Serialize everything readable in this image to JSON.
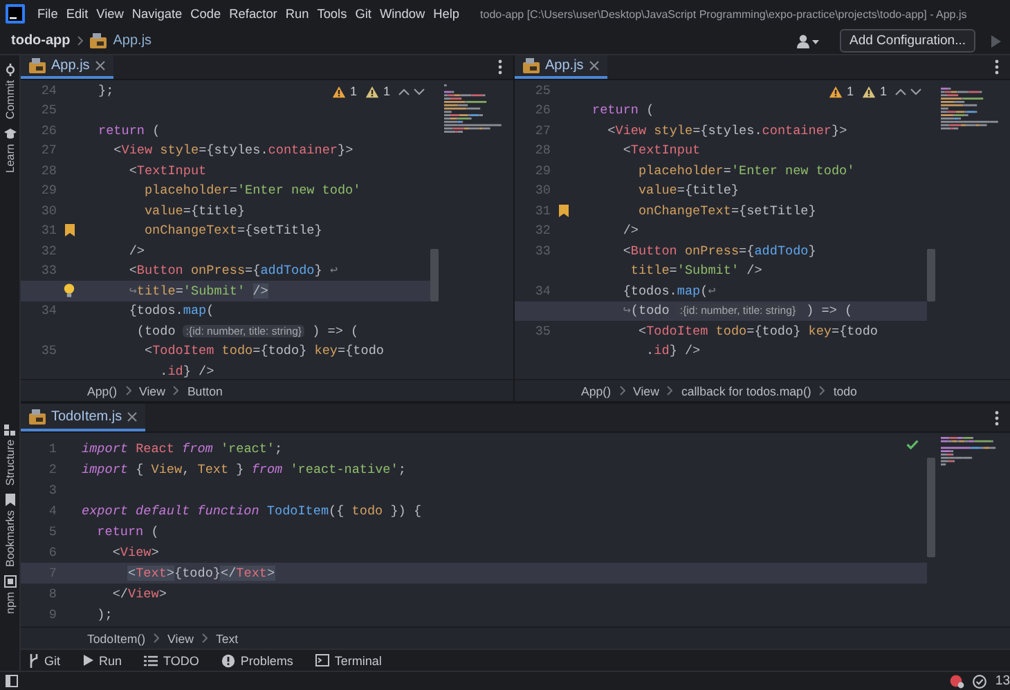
{
  "menu_bar": {
    "items": [
      "File",
      "Edit",
      "View",
      "Navigate",
      "Code",
      "Refactor",
      "Run",
      "Tools",
      "Git",
      "Window",
      "Help"
    ],
    "title": "todo-app [C:\\Users\\user\\Desktop\\JavaScript Programming\\expo-practice\\projects\\todo-app] - App.js"
  },
  "nav_bar": {
    "breadcrumbs": [
      {
        "label": "todo-app",
        "kind": "project"
      },
      {
        "label": "App.js",
        "kind": "file"
      }
    ],
    "config_button": "Add Configuration...",
    "run_disabled": true
  },
  "left_tool_strip": {
    "top": [
      "Commit",
      "Learn"
    ],
    "bottom": [
      "Structure",
      "Bookmarks",
      "npm"
    ]
  },
  "editors": [
    {
      "tabs": [
        {
          "label": "App.js",
          "selected": true
        }
      ],
      "inspections": [
        {
          "kind": "warning",
          "count": "1"
        },
        {
          "kind": "weak_warning",
          "count": "1"
        }
      ],
      "lines": [
        {
          "number": "24",
          "kind": "plain",
          "current": false,
          "tokens": [
            {
              "text": "};",
              "kind": "plain"
            }
          ]
        },
        {
          "number": "25",
          "kind": "plain",
          "current": false
        },
        {
          "number": "26",
          "kind": "plain",
          "current": false,
          "tokens": [
            {
              "text": "return",
              "kind": "kw"
            },
            {
              "text": " (",
              "kind": "plain"
            }
          ]
        },
        {
          "number": "27",
          "kind": "plain",
          "current": false,
          "tokens": [
            {
              "text": "  <",
              "kind": "plain"
            },
            {
              "text": "View ",
              "kind": "tag"
            },
            {
              "text": "style",
              "kind": "attr"
            },
            {
              "text": "={styles.",
              "kind": "plain"
            },
            {
              "text": "container",
              "kind": "prop"
            },
            {
              "text": "}>",
              "kind": "plain"
            }
          ]
        },
        {
          "number": "28",
          "kind": "plain",
          "current": false,
          "tokens": [
            {
              "text": "    <",
              "kind": "plain"
            },
            {
              "text": "TextInput",
              "kind": "tag"
            }
          ]
        },
        {
          "number": "29",
          "kind": "plain",
          "current": false,
          "tokens": [
            {
              "text": "      placeholder",
              "kind": "attr"
            },
            {
              "text": "=",
              "kind": "plain"
            },
            {
              "text": "'Enter new todo'",
              "kind": "str"
            }
          ]
        },
        {
          "number": "30",
          "kind": "plain",
          "current": false,
          "tokens": [
            {
              "text": "      value",
              "kind": "attr"
            },
            {
              "text": "={title}",
              "kind": "plain"
            }
          ]
        },
        {
          "number": "31",
          "kind": "bookmark",
          "current": false,
          "tokens": [
            {
              "text": "      onChangeText",
              "kind": "attr"
            },
            {
              "text": "={setTitle}",
              "kind": "plain"
            }
          ]
        },
        {
          "number": "32",
          "kind": "plain",
          "current": false,
          "tokens": [
            {
              "text": "    />",
              "kind": "plain"
            }
          ]
        },
        {
          "number": "33",
          "kind": "plain",
          "current": false,
          "tokens": [
            {
              "text": "    <",
              "kind": "plain"
            },
            {
              "text": "Button ",
              "kind": "tag"
            },
            {
              "text": "onPress",
              "kind": "attr"
            },
            {
              "text": "={",
              "kind": "plain"
            },
            {
              "text": "addTodo",
              "kind": "fn"
            },
            {
              "text": "} ",
              "kind": "plain"
            },
            {
              "text": "↩",
              "kind": "wrap"
            }
          ]
        },
        {
          "kind": "bulb",
          "current": true,
          "tokens": [
            {
              "text": "    ↪",
              "kind": "wrap"
            },
            {
              "text": "title",
              "kind": "attr"
            },
            {
              "text": "=",
              "kind": "plain"
            },
            {
              "text": "'Submit' ",
              "kind": "str"
            },
            {
              "text": "/>",
              "kind": "punct_hl"
            }
          ]
        },
        {
          "number": "34",
          "kind": "plain",
          "current": false,
          "tokens": [
            {
              "text": "    {todos.",
              "kind": "plain"
            },
            {
              "text": "map",
              "kind": "fn"
            },
            {
              "text": "(",
              "kind": "plain"
            }
          ]
        },
        {
          "kind": "plain",
          "current": false,
          "tokens": [
            {
              "text": "     (todo ",
              "kind": "plain"
            },
            {
              "text": ":{id: number, title: string}",
              "kind": "hint"
            },
            {
              "text": " ) => (",
              "kind": "plain"
            }
          ]
        },
        {
          "number": "35",
          "kind": "plain",
          "current": false,
          "tokens": [
            {
              "text": "      <",
              "kind": "plain"
            },
            {
              "text": "TodoItem ",
              "kind": "tag"
            },
            {
              "text": "todo",
              "kind": "attr"
            },
            {
              "text": "={todo} ",
              "kind": "plain"
            },
            {
              "text": "key",
              "kind": "attr"
            },
            {
              "text": "={todo",
              "kind": "plain"
            }
          ]
        },
        {
          "kind": "plain",
          "current": false,
          "tokens": [
            {
              "text": "        .",
              "kind": "plain"
            },
            {
              "text": "id",
              "kind": "prop"
            },
            {
              "text": "} />",
              "kind": "plain"
            }
          ]
        }
      ],
      "breadcrumbs": [
        "App()",
        "View",
        "Button"
      ]
    },
    {
      "tabs": [
        {
          "label": "App.js",
          "selected": true
        }
      ],
      "inspections": [
        {
          "kind": "warning",
          "count": "1"
        },
        {
          "kind": "weak_warning",
          "count": "1"
        }
      ],
      "lines": [
        {
          "number": "25",
          "kind": "plain",
          "current": false
        },
        {
          "number": "26",
          "kind": "plain",
          "current": false,
          "tokens": [
            {
              "text": "return",
              "kind": "kw"
            },
            {
              "text": " (",
              "kind": "plain"
            }
          ]
        },
        {
          "number": "27",
          "kind": "plain",
          "current": false,
          "tokens": [
            {
              "text": "  <",
              "kind": "plain"
            },
            {
              "text": "View ",
              "kind": "tag"
            },
            {
              "text": "style",
              "kind": "attr"
            },
            {
              "text": "={styles.",
              "kind": "plain"
            },
            {
              "text": "container",
              "kind": "prop"
            },
            {
              "text": "}>",
              "kind": "plain"
            }
          ]
        },
        {
          "number": "28",
          "kind": "plain",
          "current": false,
          "tokens": [
            {
              "text": "    <",
              "kind": "plain"
            },
            {
              "text": "TextInput",
              "kind": "tag"
            }
          ]
        },
        {
          "number": "29",
          "kind": "plain",
          "current": false,
          "tokens": [
            {
              "text": "      placeholder",
              "kind": "attr"
            },
            {
              "text": "=",
              "kind": "plain"
            },
            {
              "text": "'Enter new todo'",
              "kind": "str"
            }
          ]
        },
        {
          "number": "30",
          "kind": "plain",
          "current": false,
          "tokens": [
            {
              "text": "      value",
              "kind": "attr"
            },
            {
              "text": "={title}",
              "kind": "plain"
            }
          ]
        },
        {
          "number": "31",
          "kind": "bookmark",
          "current": false,
          "tokens": [
            {
              "text": "      onChangeText",
              "kind": "attr"
            },
            {
              "text": "={setTitle}",
              "kind": "plain"
            }
          ]
        },
        {
          "number": "32",
          "kind": "plain",
          "current": false,
          "tokens": [
            {
              "text": "    />",
              "kind": "plain"
            }
          ]
        },
        {
          "number": "33",
          "kind": "plain",
          "current": false,
          "tokens": [
            {
              "text": "    <",
              "kind": "plain"
            },
            {
              "text": "Button ",
              "kind": "tag"
            },
            {
              "text": "onPress",
              "kind": "attr"
            },
            {
              "text": "={",
              "kind": "plain"
            },
            {
              "text": "addTodo",
              "kind": "fn"
            },
            {
              "text": "}",
              "kind": "plain"
            }
          ]
        },
        {
          "kind": "plain",
          "current": false,
          "tokens": [
            {
              "text": "     title",
              "kind": "attr"
            },
            {
              "text": "=",
              "kind": "plain"
            },
            {
              "text": "'Submit'",
              "kind": "str"
            },
            {
              "text": " />",
              "kind": "plain"
            }
          ]
        },
        {
          "number": "34",
          "kind": "plain",
          "current": false,
          "tokens": [
            {
              "text": "    {todos.",
              "kind": "plain"
            },
            {
              "text": "map",
              "kind": "fn"
            },
            {
              "text": "(",
              "kind": "plain"
            },
            {
              "text": "↩",
              "kind": "wrap"
            }
          ]
        },
        {
          "kind": "plain",
          "current": true,
          "tokens": [
            {
              "text": "    ↪",
              "kind": "wrap"
            },
            {
              "text": "(todo ",
              "kind": "plain"
            },
            {
              "text": ":{id: number, title: string}",
              "kind": "hint"
            },
            {
              "text": " ) => (",
              "kind": "plain"
            }
          ]
        },
        {
          "number": "35",
          "kind": "plain",
          "current": false,
          "tokens": [
            {
              "text": "      <",
              "kind": "plain"
            },
            {
              "text": "TodoItem ",
              "kind": "tag"
            },
            {
              "text": "todo",
              "kind": "attr"
            },
            {
              "text": "={todo} ",
              "kind": "plain"
            },
            {
              "text": "key",
              "kind": "attr"
            },
            {
              "text": "={todo",
              "kind": "plain"
            }
          ]
        },
        {
          "kind": "plain",
          "current": false,
          "tokens": [
            {
              "text": "       .",
              "kind": "plain"
            },
            {
              "text": "id",
              "kind": "prop"
            },
            {
              "text": "} />",
              "kind": "plain"
            }
          ]
        }
      ],
      "breadcrumbs": [
        "App()",
        "View",
        "callback for todos.map()",
        "todo"
      ]
    },
    {
      "tabs": [
        {
          "label": "TodoItem.js",
          "selected": true
        }
      ],
      "analysis_ok": true,
      "lines": [
        {
          "number": "1",
          "kind": "plain",
          "current": false,
          "tokens": [
            {
              "text": "import ",
              "kind": "kwi"
            },
            {
              "text": "React ",
              "kind": "tag"
            },
            {
              "text": "from ",
              "kind": "kwi"
            },
            {
              "text": "'react'",
              "kind": "str"
            },
            {
              "text": ";",
              "kind": "plain"
            }
          ]
        },
        {
          "number": "2",
          "kind": "plain",
          "current": false,
          "tokens": [
            {
              "text": "import",
              "kind": "kwi"
            },
            {
              "text": " { ",
              "kind": "plain"
            },
            {
              "text": "View",
              "kind": "attr"
            },
            {
              "text": ", ",
              "kind": "plain"
            },
            {
              "text": "Text",
              "kind": "attr"
            },
            {
              "text": " } ",
              "kind": "plain"
            },
            {
              "text": "from ",
              "kind": "kwi"
            },
            {
              "text": "'react-native'",
              "kind": "str"
            },
            {
              "text": ";",
              "kind": "plain"
            }
          ]
        },
        {
          "number": "3",
          "kind": "plain",
          "current": false
        },
        {
          "number": "4",
          "kind": "plain",
          "current": false,
          "tokens": [
            {
              "text": "export default function ",
              "kind": "kwi"
            },
            {
              "text": "TodoItem",
              "kind": "fn"
            },
            {
              "text": "({ ",
              "kind": "plain"
            },
            {
              "text": "todo",
              "kind": "attr"
            },
            {
              "text": " }) {",
              "kind": "plain"
            }
          ]
        },
        {
          "number": "5",
          "kind": "plain",
          "current": false,
          "tokens": [
            {
              "text": "  return",
              "kind": "kw"
            },
            {
              "text": " (",
              "kind": "plain"
            }
          ]
        },
        {
          "number": "6",
          "kind": "plain",
          "current": false,
          "tokens": [
            {
              "text": "    <",
              "kind": "plain"
            },
            {
              "text": "View",
              "kind": "tag"
            },
            {
              "text": ">",
              "kind": "plain"
            }
          ]
        },
        {
          "number": "7",
          "kind": "plain",
          "current": true,
          "tokens": [
            {
              "text": "      <",
              "kind": "punct_hl"
            },
            {
              "text": "Text",
              "kind": "tag_hl"
            },
            {
              "text": ">",
              "kind": "punct_hl"
            },
            {
              "text": "{todo}",
              "kind": "plain"
            },
            {
              "text": "</",
              "kind": "punct_hl"
            },
            {
              "text": "Text",
              "kind": "tag_hl"
            },
            {
              "text": ">",
              "kind": "punct_hl"
            }
          ]
        },
        {
          "number": "8",
          "kind": "plain",
          "current": false,
          "tokens": [
            {
              "text": "    </",
              "kind": "plain"
            },
            {
              "text": "View",
              "kind": "tag"
            },
            {
              "text": ">",
              "kind": "plain"
            }
          ]
        },
        {
          "number": "9",
          "kind": "plain",
          "current": false,
          "tokens": [
            {
              "text": "  );",
              "kind": "plain"
            }
          ]
        }
      ],
      "breadcrumbs": [
        "TodoItem()",
        "View",
        "Text"
      ]
    }
  ],
  "tool_windows": [
    "Git",
    "Run",
    "TODO",
    "Problems",
    "Terminal"
  ],
  "status_bar": {
    "counter": "13"
  }
}
